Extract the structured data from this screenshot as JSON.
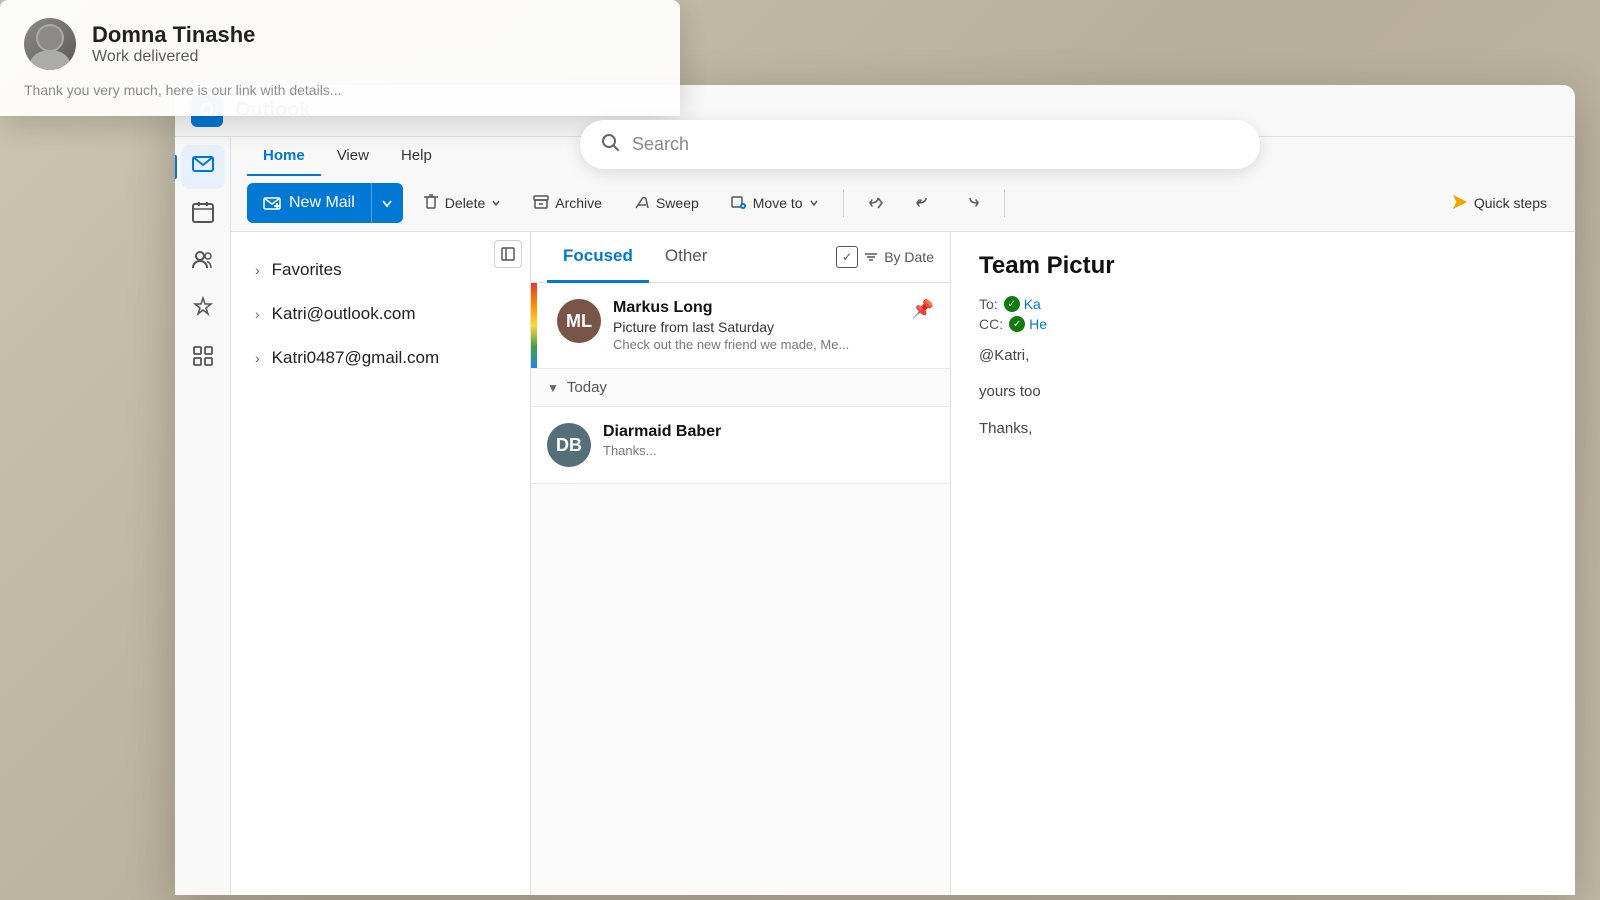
{
  "app": {
    "title": "Outlook",
    "logo_letter": "O"
  },
  "search": {
    "placeholder": "Search"
  },
  "floating_email": {
    "sender": "Domna Tinashe",
    "subject": "Work delivered",
    "body_preview": "Thank you very much, here is our link with details..."
  },
  "ribbon": {
    "tabs": [
      {
        "label": "Home",
        "active": true
      },
      {
        "label": "View",
        "active": false
      },
      {
        "label": "Help",
        "active": false
      }
    ],
    "actions": {
      "new_mail": "New Mail",
      "delete": "Delete",
      "archive": "Archive",
      "sweep": "Sweep",
      "move_to": "Move to",
      "reply": "↩",
      "reply_all": "↩↩",
      "forward": "↪",
      "quick_steps": "Quick steps"
    }
  },
  "sidebar": {
    "icons": [
      {
        "name": "mail-icon",
        "symbol": "✉",
        "active": true
      },
      {
        "name": "calendar-icon",
        "symbol": "▦",
        "active": false
      },
      {
        "name": "people-icon",
        "symbol": "👥",
        "active": false
      },
      {
        "name": "tasks-icon",
        "symbol": "📎",
        "active": false
      },
      {
        "name": "apps-icon",
        "symbol": "⊞",
        "active": false
      }
    ]
  },
  "folders": {
    "panel_toggle": "⬛",
    "items": [
      {
        "label": "Favorites"
      },
      {
        "label": "Katri@outlook.com"
      },
      {
        "label": "Katri0487@gmail.com"
      }
    ]
  },
  "email_list": {
    "tabs": [
      {
        "label": "Focused",
        "active": true
      },
      {
        "label": "Other",
        "active": false
      }
    ],
    "filter": {
      "sort_label": "By Date"
    },
    "emails": [
      {
        "sender": "Markus Long",
        "subject": "Picture from last Saturday",
        "preview": "Check out the new friend we made, Me...",
        "has_color_strip": true,
        "pinned": true,
        "avatar_color": "#795548",
        "avatar_initials": "ML"
      },
      {
        "sender": "Diarmaid Baber",
        "subject": "",
        "preview": "Thanks...",
        "has_color_strip": false,
        "pinned": false,
        "avatar_color": "#546e7a",
        "avatar_initials": "DB"
      }
    ],
    "sections": [
      {
        "label": "Today"
      }
    ]
  },
  "reading_pane": {
    "title": "Team Pictur",
    "to_label": "To:",
    "cc_label": "CC:",
    "recipient1": "Ka",
    "recipient2": "He",
    "at_mention": "@Katri,",
    "body": "yours too",
    "thanks": "Thanks,"
  }
}
